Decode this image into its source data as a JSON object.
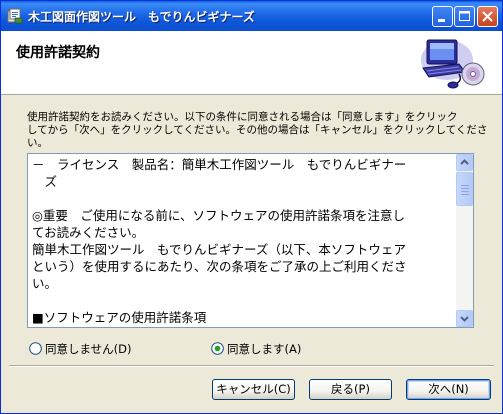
{
  "window": {
    "title": "木工図面作図ツール　もでりんビギナーズ"
  },
  "header": {
    "title": "使用許諾契約"
  },
  "instruction": {
    "line1": "使用許諾契約をお読みください。以下の条件に同意される場合は「同意します」をクリック",
    "line2": "してから「次へ」をクリックしてください。その他の場合は「キャンセル」をクリックしてくださ",
    "line3": "い。"
  },
  "license": {
    "lines": [
      "－　ライセンス　製品名：簡単木工作図ツール　もでりんビギナー",
      "　ズ",
      "",
      "◎重要　ご使用になる前に、ソフトウェアの使用許諾条項を注意し",
      "てお読みください。",
      "簡単木工作図ツール　もでりんビギナーズ（以下、本ソフトウェア",
      "という）を使用するにあたり、次の条項をご了承の上ご利用くださ",
      "い。",
      "",
      "■ソフトウェアの使用許諾条項"
    ]
  },
  "options": {
    "disagree_label": "同意しません(D)",
    "agree_label": "同意します(A)",
    "selected": "agree"
  },
  "buttons": {
    "cancel_label": "キャンセル(C)",
    "back_label": "戻る(P)",
    "next_label": "次へ(N)"
  },
  "colors": {
    "titlebar": "#0a5fe3",
    "dialog_face": "#ece9d8",
    "radio_selected": "#21a121"
  },
  "icons": {
    "app": "app-icon",
    "header": "computer-cd-icon"
  }
}
